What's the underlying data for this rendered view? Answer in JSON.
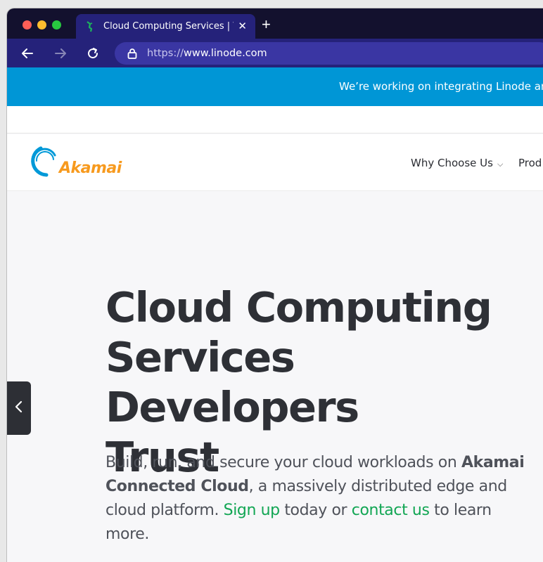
{
  "browser": {
    "tab_title": "Cloud Computing Services | Vi",
    "tab_close": "✕",
    "new_tab": "+",
    "url_prefix": "https://",
    "url_domain": "www.linode.com"
  },
  "page": {
    "banner_text": "We’re working on integrating Linode and",
    "logo_text": "Akamai",
    "nav": {
      "why_choose_us": "Why Choose Us",
      "products": "Prod"
    },
    "hero": {
      "title_line1": "Cloud Computing",
      "title_line2": "Services Developers",
      "title_line3": "Trust",
      "text_part1": "Build, run, and secure your cloud workloads on ",
      "text_bold": "Akamai Connected Cloud",
      "text_part2": ", a massively distributed edge and cloud platform. ",
      "sign_up": "Sign up",
      "text_part3": " today or ",
      "contact_us": "contact us",
      "text_part4": " to learn more."
    }
  },
  "colors": {
    "banner": "#0096d6",
    "brand_orange": "#f79a1e",
    "brand_blue": "#0099d8",
    "link_green": "#12a654",
    "toolbar": "#25227a"
  },
  "icons": [
    "linode-favicon-icon",
    "close-icon",
    "plus-icon",
    "back-arrow-icon",
    "forward-arrow-icon",
    "reload-icon",
    "lock-icon",
    "chevron-down-icon",
    "chevron-left-icon"
  ]
}
